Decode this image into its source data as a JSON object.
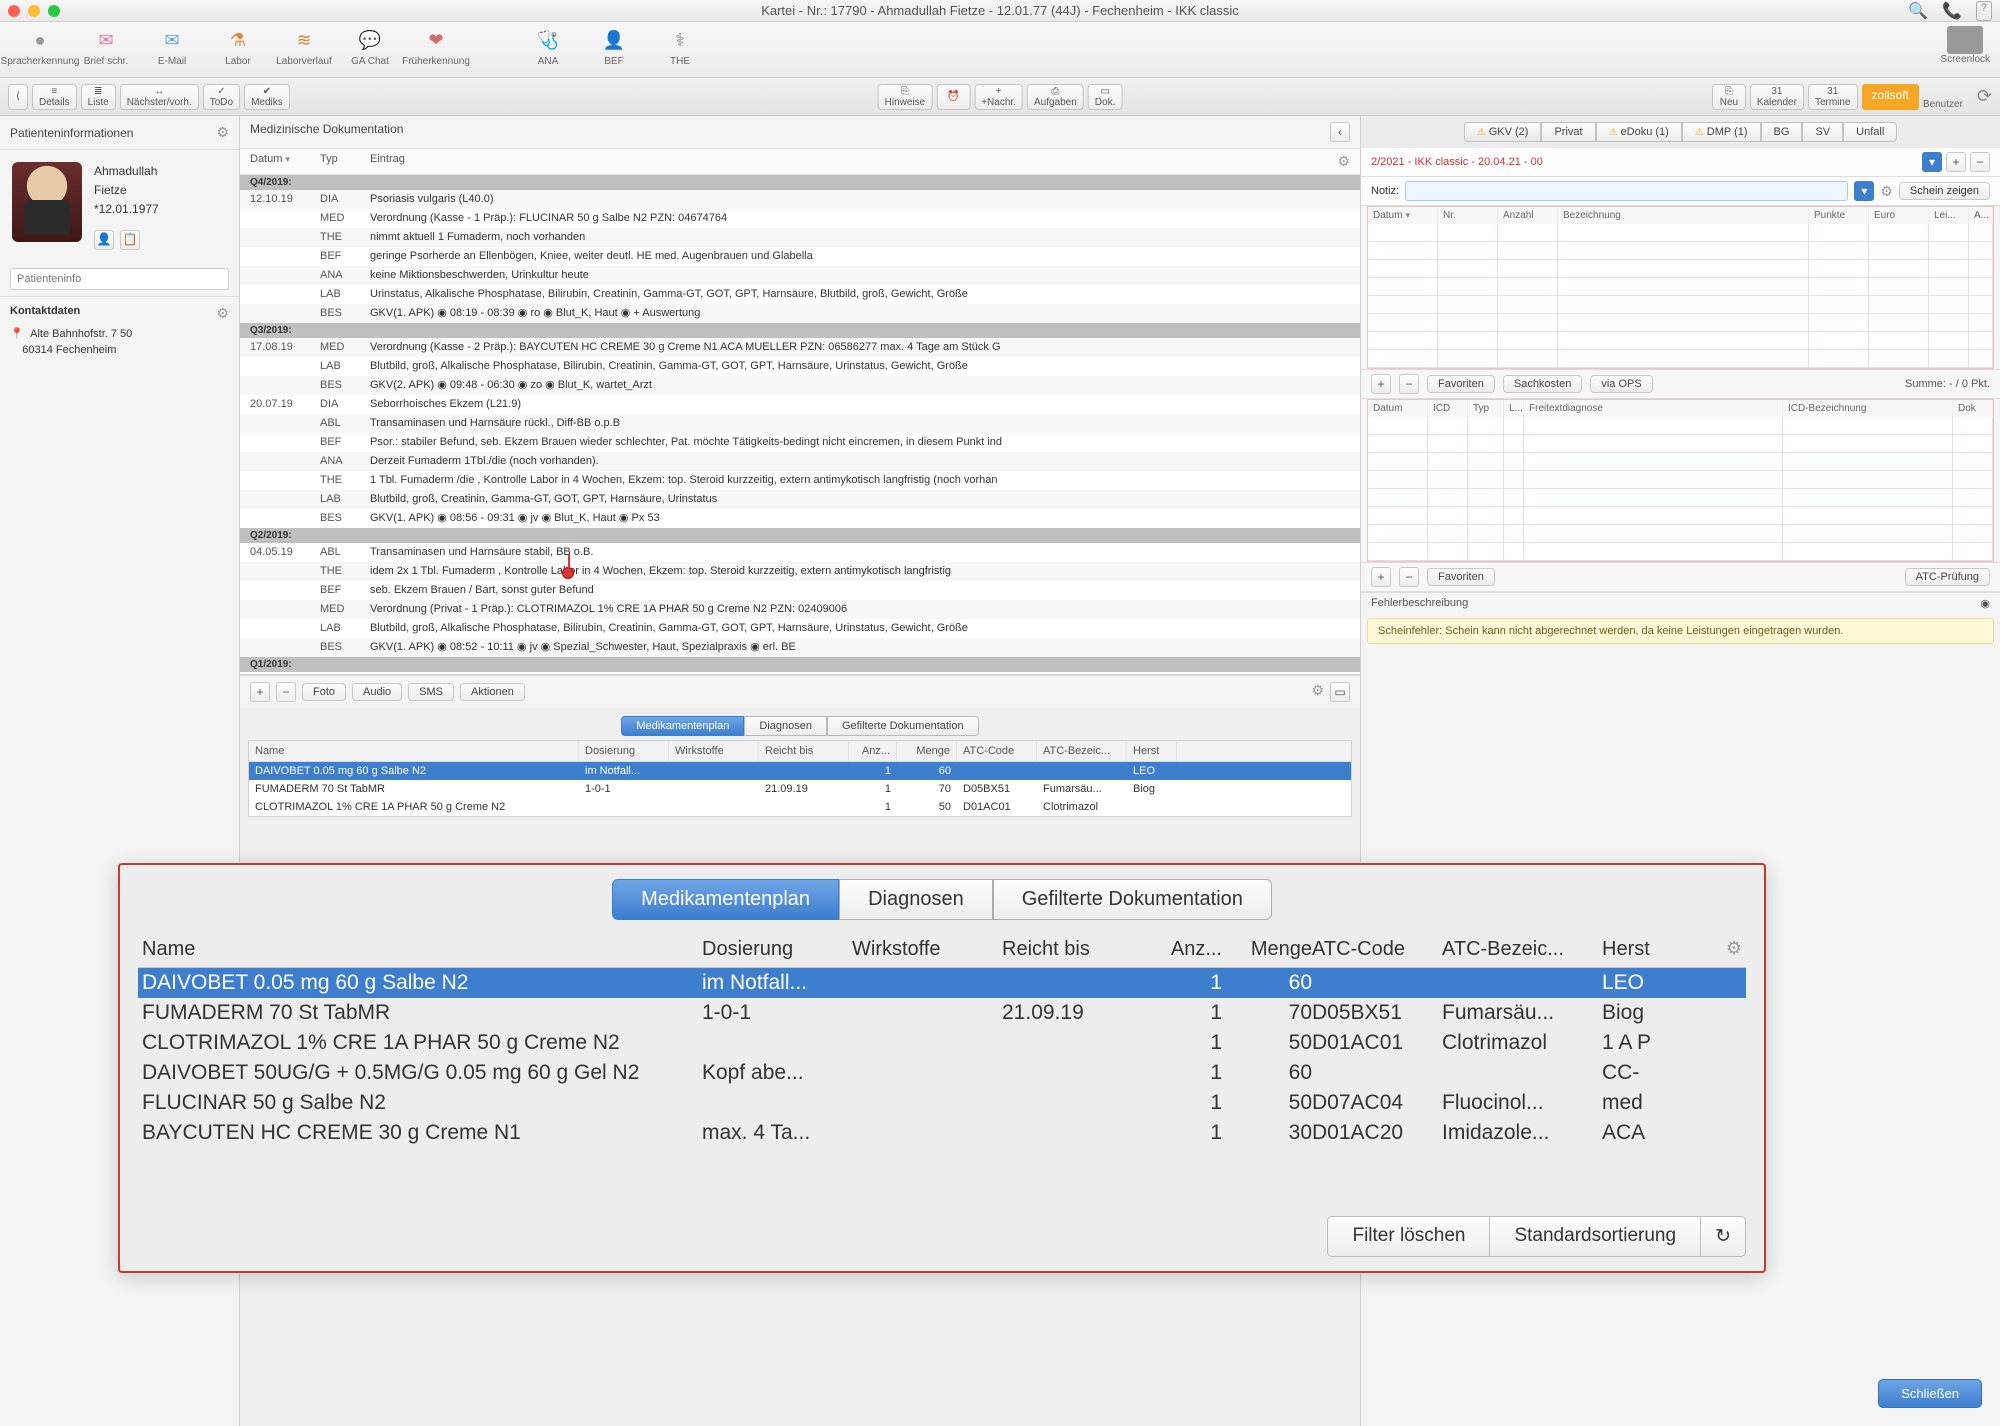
{
  "window": {
    "title": "Kartei - Nr.: 17790 - Ahmadullah Fietze - 12.01.77 (44J) - Fechenheim - IKK classic"
  },
  "toolbar": [
    {
      "label": "Spracherkennung",
      "color": "#9a9a9a",
      "glyph": "●"
    },
    {
      "label": "Brief schr.",
      "color": "#e07aa8",
      "glyph": "✉"
    },
    {
      "label": "E-Mail",
      "color": "#6aa7d6",
      "glyph": "✉"
    },
    {
      "label": "Labor",
      "color": "#e0893a",
      "glyph": "⚗"
    },
    {
      "label": "Laborverlauf",
      "color": "#e0893a",
      "glyph": "≋"
    },
    {
      "label": "GA Chat",
      "color": "#7ac27a",
      "glyph": "💬"
    },
    {
      "label": "Früherkennung",
      "color": "#d66a6a",
      "glyph": "❤"
    }
  ],
  "toolbar2": [
    {
      "label": "ANA",
      "glyph": "🩺"
    },
    {
      "label": "BEF",
      "glyph": "👤"
    },
    {
      "label": "THE",
      "glyph": "⚕"
    }
  ],
  "screenlock": "Screenlock",
  "subtoolbar_left": [
    {
      "label": "Details",
      "glyph": "≡"
    },
    {
      "label": "Liste",
      "glyph": "≣"
    },
    {
      "label": "Nächster/vorh.",
      "glyph": "↔"
    },
    {
      "label": "ToDo",
      "glyph": "✓"
    },
    {
      "label": "Mediks",
      "glyph": "✔"
    }
  ],
  "subtoolbar_center": [
    {
      "label": "Hinweise",
      "glyph": "⎘"
    },
    {
      "label": "",
      "glyph": "⏰"
    },
    {
      "label": "+Nachr.",
      "glyph": "+"
    },
    {
      "label": "Aufgaben",
      "glyph": "⎙"
    },
    {
      "label": "Dok.",
      "glyph": "▭"
    }
  ],
  "subtoolbar_right": [
    {
      "label": "Neu",
      "glyph": "⎘"
    },
    {
      "label": "Kalender",
      "glyph": "31"
    },
    {
      "label": "Termine",
      "glyph": "31"
    },
    {
      "label": "Benutzer",
      "glyph": "zollsoft"
    }
  ],
  "left": {
    "panel": "Patienteninformationen",
    "firstname": "Ahmadullah",
    "lastname": "Fietze",
    "dob": "*12.01.1977",
    "info_placeholder": "Patienteninfo",
    "contact_hdr": "Kontaktdaten",
    "addr1": "Alte Bahnhofstr. 7 50",
    "addr2": "60314 Fechenheim"
  },
  "mid": {
    "head": "Medizinische Dokumentation",
    "cols": {
      "datum": "Datum",
      "typ": "Typ",
      "eintrag": "Eintrag"
    },
    "quarters": [
      {
        "q": "Q4/2019:",
        "rows": [
          {
            "d": "12.10.19",
            "t": "DIA",
            "e": "Psoriasis vulgaris (L40.0)"
          },
          {
            "d": "",
            "t": "MED",
            "e": "Verordnung (Kasse - 1 Präp.): FLUCINAR 50 g Salbe N2 PZN: 04674764"
          },
          {
            "d": "",
            "t": "THE",
            "e": "nimmt aktuell 1 Fumaderm, noch vorhanden"
          },
          {
            "d": "",
            "t": "BEF",
            "e": "geringe Psorherde an Ellenbögen, Kniee, weiter deutl. HE med. Augenbrauen und Glabella"
          },
          {
            "d": "",
            "t": "ANA",
            "e": "keine Miktionsbeschwerden, Urinkultur heute"
          },
          {
            "d": "",
            "t": "LAB",
            "e": "Urinstatus, Alkalische Phosphatase, Bilirubin, Creatinin, Gamma-GT, GOT, GPT, Harnsäure, Blutbild, groß, Gewicht, Größe"
          },
          {
            "d": "",
            "t": "BES",
            "e": "GKV(1. APK) ◉ 08:19 - 08:39 ◉ ro ◉ Blut_K, Haut ◉ + Auswertung"
          }
        ]
      },
      {
        "q": "Q3/2019:",
        "rows": [
          {
            "d": "17.08.19",
            "t": "MED",
            "e": "Verordnung (Kasse - 2 Präp.): BAYCUTEN HC CREME 30 g Creme N1 ACA MUELLER PZN: 06586277 max. 4 Tage am Stück G"
          },
          {
            "d": "",
            "t": "LAB",
            "e": "Blutbild, groß, Alkalische Phosphatase, Bilirubin, Creatinin, Gamma-GT, GOT, GPT, Harnsäure, Urinstatus, Gewicht, Größe"
          },
          {
            "d": "",
            "t": "BES",
            "e": "GKV(2. APK) ◉ 09:48 - 06:30 ◉ zo ◉ Blut_K, wartet_Arzt"
          },
          {
            "d": "20.07.19",
            "t": "DIA",
            "e": "Seborrhoisches Ekzem (L21.9)"
          },
          {
            "d": "",
            "t": "ABL",
            "e": "Transaminasen und Harnsäure rückl., Diff-BB o.p.B"
          },
          {
            "d": "",
            "t": "BEF",
            "e": "Psor.: stabiler Befund, seb. Ekzem Brauen wieder schlechter, Pat. möchte Tätigkeits-bedingt nicht eincremen, in diesem Punkt ind"
          },
          {
            "d": "",
            "t": "ANA",
            "e": "Derzeit Fumaderm 1Tbl./die (noch vorhanden)."
          },
          {
            "d": "",
            "t": "THE",
            "e": "1 Tbl. Fumaderm /die , Kontrolle Labor in 4 Wochen, Ekzem: top. Steroid kurzzeitig, extern antimykotisch langfristig (noch vorhan"
          },
          {
            "d": "",
            "t": "LAB",
            "e": "Blutbild, groß, Creatinin, Gamma-GT, GOT, GPT, Harnsäure, Urinstatus"
          },
          {
            "d": "",
            "t": "BES",
            "e": "GKV(1. APK) ◉ 08:56 - 09:31 ◉ jv ◉ Blut_K, Haut ◉ Px 53"
          }
        ]
      },
      {
        "q": "Q2/2019:",
        "rows": [
          {
            "d": "04.05.19",
            "t": "ABL",
            "e": "Transaminasen und Harnsäure stabil, BB o.B."
          },
          {
            "d": "",
            "t": "THE",
            "e": "idem 2x 1 Tbl. Fumaderm , Kontrolle Labor in 4 Wochen, Ekzem: top. Steroid kurzzeitig, extern antimykotisch langfristig"
          },
          {
            "d": "",
            "t": "BEF",
            "e": "seb. Ekzem Brauen / Bart, sonst guter Befund"
          },
          {
            "d": "",
            "t": "MED",
            "e": "Verordnung (Privat - 1 Präp.): CLOTRIMAZOL 1% CRE 1A PHAR 50 g Creme N2 PZN: 02409006"
          },
          {
            "d": "",
            "t": "LAB",
            "e": "Blutbild, groß, Alkalische Phosphatase, Bilirubin, Creatinin, Gamma-GT, GOT, GPT, Harnsäure, Urinstatus, Gewicht, Größe"
          },
          {
            "d": "",
            "t": "BES",
            "e": "GKV(1. APK) ◉ 08:52 - 10:11 ◉ jv ◉ Spezial_Schwester, Haut, Spezialpraxis ◉ erl. BE"
          }
        ]
      },
      {
        "q": "Q1/2019:",
        "rows": []
      }
    ],
    "footer": {
      "foto": "Foto",
      "audio": "Audio",
      "sms": "SMS",
      "aktionen": "Aktionen"
    },
    "tabs": {
      "med": "Medikamentenplan",
      "diag": "Diagnosen",
      "gef": "Gefilterte Dokumentation"
    },
    "medcols": {
      "name": "Name",
      "dos": "Dosierung",
      "wirk": "Wirkstoffe",
      "reicht": "Reicht bis",
      "anz": "Anz...",
      "menge": "Menge",
      "atc": "ATC-Code",
      "atcb": "ATC-Bezeic...",
      "herst": "Herst"
    },
    "meds": [
      {
        "name": "DAIVOBET 0.05 mg 60 g Salbe N2",
        "dos": "im Notfall...",
        "wirk": "",
        "reicht": "",
        "anz": "1",
        "menge": "60",
        "atc": "",
        "atcb": "",
        "herst": "LEO",
        "sel": true
      },
      {
        "name": "FUMADERM 70 St TabMR",
        "dos": "1-0-1",
        "wirk": "",
        "reicht": "21.09.19",
        "anz": "1",
        "menge": "70",
        "atc": "D05BX51",
        "atcb": "Fumarsäu...",
        "herst": "Biog"
      },
      {
        "name": "CLOTRIMAZOL 1% CRE 1A PHAR 50 g Creme N2",
        "dos": "",
        "wirk": "",
        "reicht": "",
        "anz": "1",
        "menge": "50",
        "atc": "D01AC01",
        "atcb": "Clotrimazol",
        "herst": ""
      }
    ]
  },
  "right": {
    "tabs": [
      {
        "label": "GKV (2)",
        "warn": true,
        "active": true
      },
      {
        "label": "Privat"
      },
      {
        "label": "eDoku (1)",
        "warn": true
      },
      {
        "label": "DMP (1)",
        "warn": true
      },
      {
        "label": "BG"
      },
      {
        "label": "SV"
      },
      {
        "label": "Unfall"
      }
    ],
    "ikk": "2/2021 - IKK classic - 20.04.21 - 00",
    "notiz": "Notiz:",
    "schein": "Schein zeigen",
    "grid1cols": {
      "datum": "Datum",
      "nr": "Nr.",
      "anz": "Anzahl",
      "bez": "Bezeichnung",
      "punkte": "Punkte",
      "euro": "Euro",
      "lei": "Lei...",
      "a": "A..."
    },
    "favrow": {
      "fav": "Favoriten",
      "sach": "Sachkosten",
      "ops": "via OPS",
      "summe": "Summe: - / 0 Pkt."
    },
    "grid2cols": {
      "datum": "Datum",
      "icd": "ICD",
      "typ": "Typ",
      "l": "L...",
      "frei": "Freitextdiagnose",
      "icdb": "ICD-Bezeichnung",
      "dok": "Dok"
    },
    "fav2": "Favoriten",
    "atcp": "ATC-Prüfung",
    "fb_head": "Fehlerbeschreibung",
    "fb_text": "Scheinfehler: Schein kann nicht abgerechnet werden, da keine Leistungen eingetragen wurden.",
    "close": "Schließen"
  },
  "zoom": {
    "tabs": {
      "med": "Medikamentenplan",
      "diag": "Diagnosen",
      "gef": "Gefilterte Dokumentation"
    },
    "cols": {
      "name": "Name",
      "dos": "Dosierung",
      "wirk": "Wirkstoffe",
      "reicht": "Reicht bis",
      "anz": "Anz...",
      "menge": "Menge",
      "atc": "ATC-Code",
      "atcb": "ATC-Bezeic...",
      "herst": "Herst"
    },
    "rows": [
      {
        "name": "DAIVOBET 0.05 mg 60 g Salbe N2",
        "dos": "im Notfall...",
        "wirk": "",
        "reicht": "",
        "anz": "1",
        "menge": "60",
        "atc": "",
        "atcb": "",
        "herst": "LEO",
        "sel": true
      },
      {
        "name": "FUMADERM 70 St TabMR",
        "dos": "1-0-1",
        "wirk": "",
        "reicht": "21.09.19",
        "anz": "1",
        "menge": "70",
        "atc": "D05BX51",
        "atcb": "Fumarsäu...",
        "herst": "Biog"
      },
      {
        "name": "CLOTRIMAZOL 1% CRE 1A PHAR 50 g Creme N2",
        "dos": "",
        "wirk": "",
        "reicht": "",
        "anz": "1",
        "menge": "50",
        "atc": "D01AC01",
        "atcb": "Clotrimazol",
        "herst": "1 A P"
      },
      {
        "name": "DAIVOBET 50UG/G + 0.5MG/G 0.05 mg 60 g Gel N2",
        "dos": "Kopf abe...",
        "wirk": "",
        "reicht": "",
        "anz": "1",
        "menge": "60",
        "atc": "",
        "atcb": "",
        "herst": "CC-"
      },
      {
        "name": "FLUCINAR 50 g Salbe N2",
        "dos": "",
        "wirk": "",
        "reicht": "",
        "anz": "1",
        "menge": "50",
        "atc": "D07AC04",
        "atcb": "Fluocinol...",
        "herst": "med"
      },
      {
        "name": "BAYCUTEN HC CREME 30 g Creme N1",
        "dos": "max. 4 Ta...",
        "wirk": "",
        "reicht": "",
        "anz": "1",
        "menge": "30",
        "atc": "D01AC20",
        "atcb": "Imidazole...",
        "herst": "ACA"
      }
    ],
    "filter": "Filter löschen",
    "sort": "Standardsortierung"
  }
}
